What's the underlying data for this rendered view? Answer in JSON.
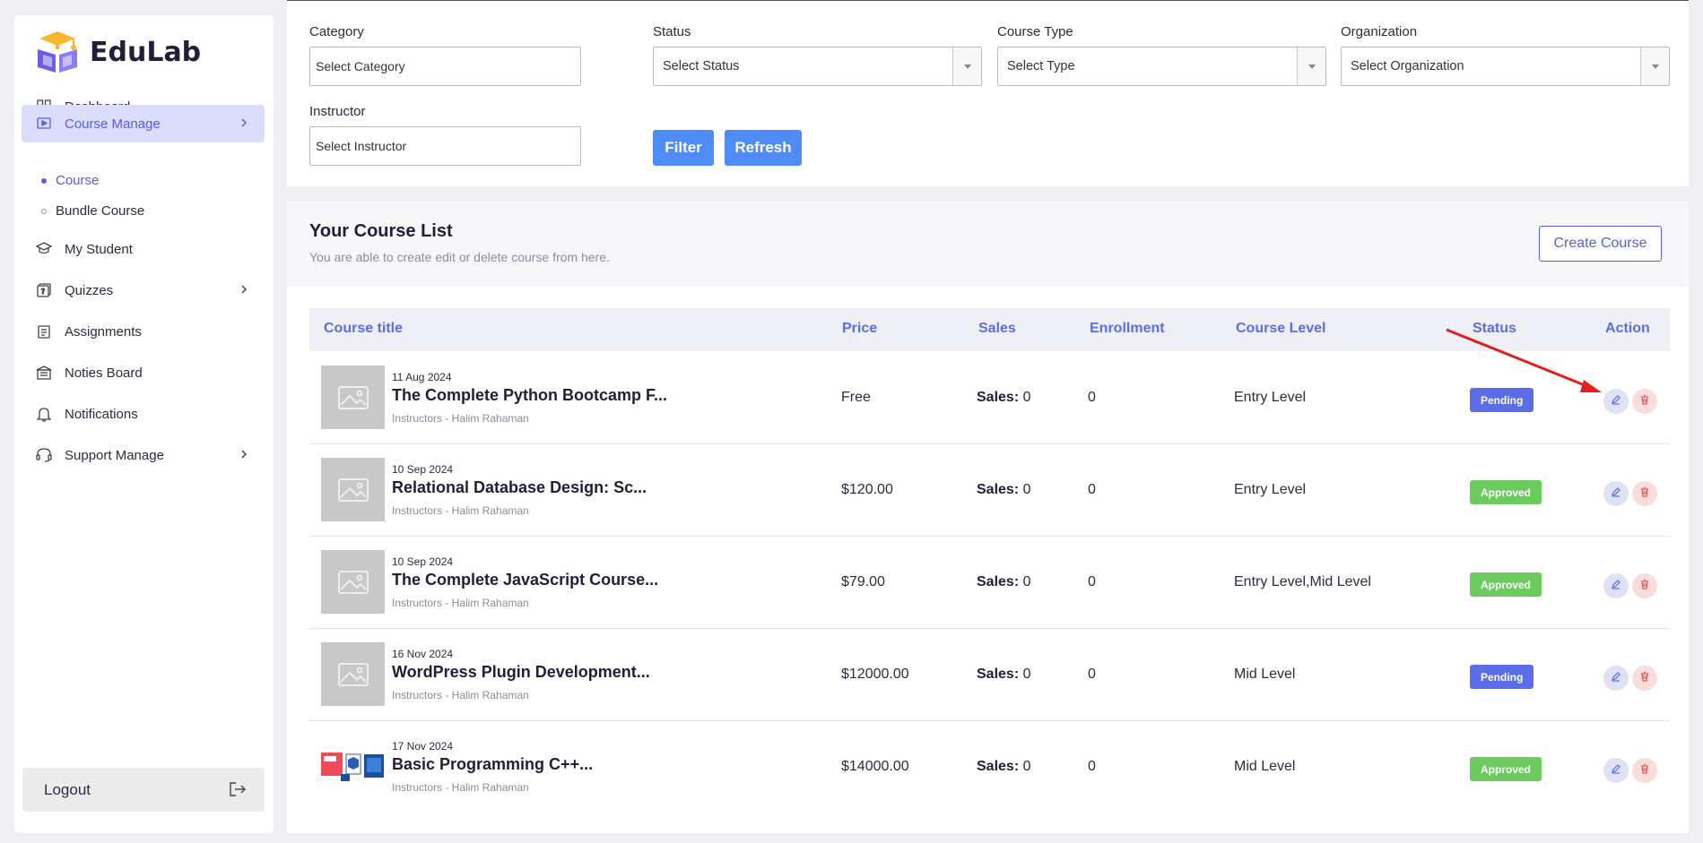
{
  "brand": {
    "name": "EduLab"
  },
  "sidebar": {
    "items": [
      {
        "label": "Dashboard",
        "icon": "grid-icon"
      },
      {
        "label": "Course Manage",
        "icon": "play-icon",
        "active": true
      },
      {
        "label": "My Student",
        "icon": "graduate-icon"
      },
      {
        "label": "Quizzes",
        "icon": "quiz-icon"
      },
      {
        "label": "Assignments",
        "icon": "clipboard-icon"
      },
      {
        "label": "Noties Board",
        "icon": "board-icon"
      },
      {
        "label": "Notifications",
        "icon": "bell-icon"
      },
      {
        "label": "Support Manage",
        "icon": "headset-icon"
      }
    ],
    "subitems": [
      {
        "label": "Course",
        "active": true
      },
      {
        "label": "Bundle Course"
      }
    ],
    "logout": "Logout"
  },
  "filters": {
    "category_label": "Category",
    "category_placeholder": "Select Category",
    "status_label": "Status",
    "status_value": "Select Status",
    "type_label": "Course Type",
    "type_value": "Select Type",
    "org_label": "Organization",
    "org_value": "Select Organization",
    "instructor_label": "Instructor",
    "instructor_placeholder": "Select Instructor",
    "filter_button": "Filter",
    "refresh_button": "Refresh"
  },
  "course_list": {
    "title": "Your Course List",
    "subtitle": "You are able to create edit or delete course from here.",
    "create_button": "Create Course",
    "columns": [
      "Course title",
      "Price",
      "Sales",
      "Enrollment",
      "Course Level",
      "Status",
      "Action"
    ],
    "sales_prefix": "Sales:",
    "rows": [
      {
        "date": "11 Aug 2024",
        "title": "The Complete Python Bootcamp F...",
        "instructor": "Instructors - Halim Rahaman",
        "price": "Free",
        "sales": "0",
        "enrollment": "0",
        "level": "Entry Level",
        "status": "Pending"
      },
      {
        "date": "10 Sep 2024",
        "title": "Relational Database Design: Sc...",
        "instructor": "Instructors - Halim Rahaman",
        "price": "$120.00",
        "sales": "0",
        "enrollment": "0",
        "level": "Entry Level",
        "status": "Approved"
      },
      {
        "date": "10 Sep 2024",
        "title": "The Complete JavaScript Course...",
        "instructor": "Instructors - Halim Rahaman",
        "price": "$79.00",
        "sales": "0",
        "enrollment": "0",
        "level": "Entry Level,Mid Level",
        "status": "Approved"
      },
      {
        "date": "16 Nov 2024",
        "title": "WordPress Plugin Development...",
        "instructor": "Instructors - Halim Rahaman",
        "price": "$12000.00",
        "sales": "0",
        "enrollment": "0",
        "level": "Mid Level",
        "status": "Pending"
      },
      {
        "date": "17 Nov 2024",
        "title": "Basic Programming C++...",
        "instructor": "Instructors - Halim Rahaman",
        "price": "$14000.00",
        "sales": "0",
        "enrollment": "0",
        "level": "Mid Level",
        "status": "Approved"
      }
    ]
  },
  "colors": {
    "accent": "#5b5be6",
    "pending": "#5b6ee8",
    "approved": "#6ccb5f",
    "button_blue": "#4f8cf7",
    "annotation_arrow": "#e02020"
  }
}
